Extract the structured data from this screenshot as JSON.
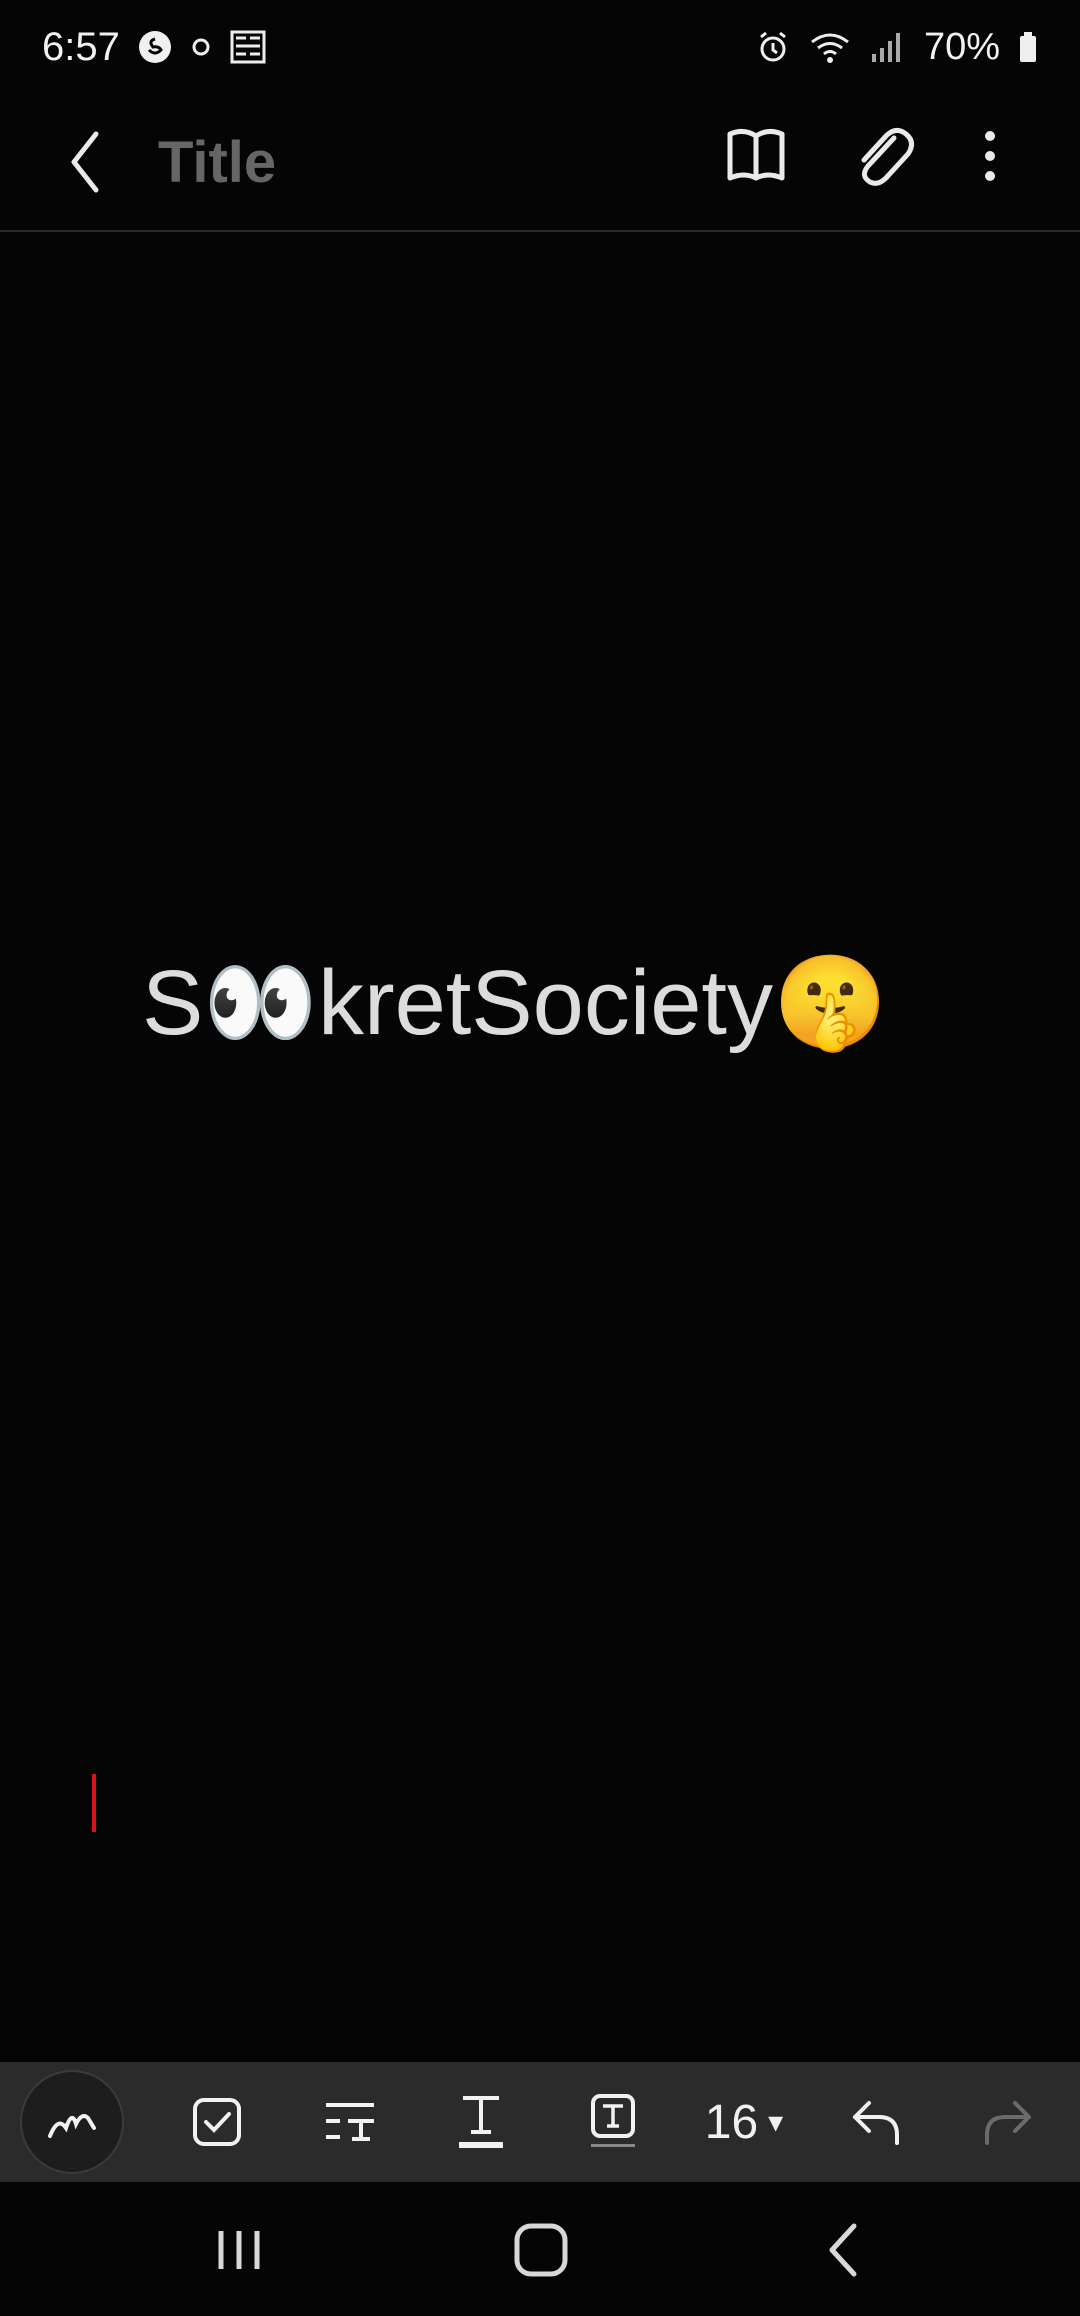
{
  "status_bar": {
    "time": "6:57",
    "battery": "70%"
  },
  "app_bar": {
    "title_placeholder": "Title"
  },
  "note": {
    "content_parts": [
      "S",
      "👀",
      "kretSociety",
      "🤫"
    ]
  },
  "toolbar": {
    "font_size": "16"
  },
  "colors": {
    "background": "#050505",
    "toolbar": "#2b2b2b",
    "cursor": "#d5141c",
    "title_placeholder": "#666666"
  }
}
